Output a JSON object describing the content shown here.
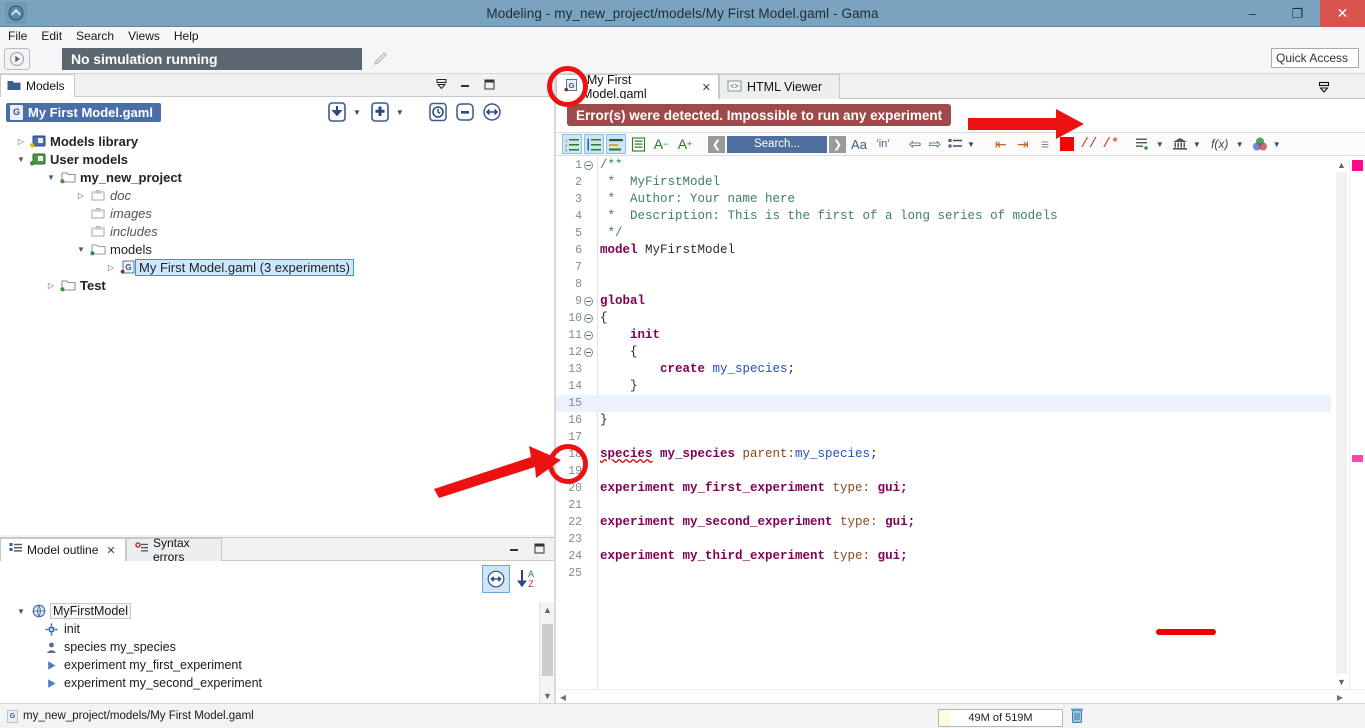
{
  "window": {
    "title": "Modeling - my_new_project/models/My First Model.gaml - Gama",
    "app_icon": "gama-app-icon",
    "minimize": "–",
    "maximize": "❐",
    "close": "✕"
  },
  "menu": {
    "items": [
      {
        "label": "File",
        "accel": "F"
      },
      {
        "label": "Edit",
        "accel": "E"
      },
      {
        "label": "Search",
        "accel": "a"
      },
      {
        "label": "Views",
        "accel": "V"
      },
      {
        "label": "Help",
        "accel": "H"
      }
    ]
  },
  "toolbar": {
    "run_icon": "play-icon",
    "simulation_status": "No simulation running",
    "edit_icon": "pencil-icon",
    "quick_access": "Quick Access"
  },
  "left_panel": {
    "tab": {
      "label": "Models",
      "icon": "folder-icon"
    },
    "view_controls": [
      "minimize-view-icon",
      "minimize-icon",
      "maximize-icon"
    ],
    "header_chip": {
      "label": "My First Model.gaml",
      "icon": "gaml-file-icon"
    },
    "tools": [
      {
        "name": "import-model-icon",
        "has_dropdown": true
      },
      {
        "name": "new-model-icon",
        "has_dropdown": true
      },
      {
        "name": "history-icon",
        "has_dropdown": false
      },
      {
        "name": "collapse-all-icon",
        "has_dropdown": false
      },
      {
        "name": "link-editor-icon",
        "has_dropdown": false
      }
    ],
    "tree": [
      {
        "label": "Models library",
        "indent": 0,
        "twist": "collapsed",
        "icon": "library-icon",
        "style": "bold"
      },
      {
        "label": "User models",
        "indent": 0,
        "twist": "expanded",
        "icon": "user-models-icon",
        "style": "bold"
      },
      {
        "label": "my_new_project",
        "indent": 1,
        "twist": "expanded",
        "icon": "project-folder-icon",
        "style": "bold"
      },
      {
        "label": "doc",
        "indent": 2,
        "twist": "collapsed",
        "icon": "folder-closed-icon",
        "style": "italic"
      },
      {
        "label": "images",
        "indent": 2,
        "twist": "none",
        "icon": "folder-closed-icon",
        "style": "italic"
      },
      {
        "label": "includes",
        "indent": 2,
        "twist": "none",
        "icon": "folder-closed-icon",
        "style": "italic"
      },
      {
        "label": "models",
        "indent": 2,
        "twist": "expanded",
        "icon": "folder-open-icon",
        "style": "plain"
      },
      {
        "label": "My First Model.gaml (3 experiments)",
        "indent": 3,
        "twist": "collapsed",
        "icon": "gaml-file-icon",
        "style": "selected"
      },
      {
        "label": "Test",
        "indent": 1,
        "twist": "collapsed",
        "icon": "project-folder-icon",
        "style": "bold"
      }
    ]
  },
  "outline_panel": {
    "tabs": [
      {
        "label": "Model outline",
        "icon": "outline-icon",
        "active": true,
        "closeable": true
      },
      {
        "label": "Syntax errors",
        "icon": "error-outline-icon",
        "active": false,
        "closeable": false
      }
    ],
    "view_controls": [
      "minimize-icon",
      "maximize-icon"
    ],
    "tools": [
      {
        "name": "link-with-editor-icon",
        "active": true
      },
      {
        "name": "sort-az-icon",
        "active": false
      }
    ],
    "items": [
      {
        "label": "MyFirstModel",
        "indent": 0,
        "twist": "expanded",
        "icon": "globe-icon",
        "selected": true
      },
      {
        "label": "init",
        "indent": 1,
        "twist": "none",
        "icon": "gear-icon",
        "selected": false
      },
      {
        "label": "species my_species",
        "indent": 1,
        "twist": "none",
        "icon": "person-icon",
        "selected": false
      },
      {
        "label": "experiment my_first_experiment",
        "indent": 1,
        "twist": "none",
        "icon": "play-triangle-icon",
        "selected": false
      },
      {
        "label": "experiment my_second_experiment",
        "indent": 1,
        "twist": "none",
        "icon": "play-triangle-icon",
        "selected": false
      }
    ]
  },
  "editor": {
    "tabs": [
      {
        "label": "*My First Model.gaml",
        "icon": "gaml-file-icon",
        "active": true,
        "closeable": true
      },
      {
        "label": "HTML Viewer",
        "icon": "html-viewer-icon",
        "active": false,
        "closeable": false
      }
    ],
    "restore_icon": "restore-view-icon",
    "error_banner": "Error(s) were detected. Impossible to run any experiment",
    "toolbar": [
      {
        "name": "outline-numbered-icon",
        "glyph": "≡",
        "active": true
      },
      {
        "name": "outline-tree-icon",
        "glyph": "≡",
        "active": true
      },
      {
        "name": "outline-mixed-icon",
        "glyph": "≡",
        "active": true
      },
      {
        "name": "word-wrap-icon",
        "glyph": "▤",
        "active": false
      },
      {
        "name": "decrease-font-icon",
        "glyph": "A⁻",
        "active": false
      },
      {
        "name": "increase-font-icon",
        "glyph": "A⁺",
        "active": false
      },
      {
        "name": "search-prev-icon",
        "glyph": "❮",
        "active": false
      },
      {
        "name": "search-input",
        "glyph": "Search...",
        "active": false
      },
      {
        "name": "search-next-icon",
        "glyph": "❯",
        "active": false
      },
      {
        "name": "case-sensitive-icon",
        "glyph": "Aa",
        "active": false
      },
      {
        "name": "whole-word-icon",
        "glyph": "'in'",
        "active": false
      },
      {
        "name": "navigate-back-icon",
        "glyph": "⇦",
        "active": false
      },
      {
        "name": "navigate-forward-icon",
        "glyph": "⇨",
        "active": false
      },
      {
        "name": "markers-list-icon",
        "glyph": "≔",
        "active": false,
        "has_dropdown": true
      },
      {
        "name": "unindent-icon",
        "glyph": "⇤",
        "active": false
      },
      {
        "name": "indent-icon",
        "glyph": "⇥",
        "active": false
      },
      {
        "name": "format-icon",
        "glyph": "≡",
        "active": false
      },
      {
        "name": "color-picker-icon",
        "glyph": "■",
        "active": false
      },
      {
        "name": "line-comment-icon",
        "glyph": "//",
        "active": false
      },
      {
        "name": "block-comment-icon",
        "glyph": "/*",
        "active": false
      },
      {
        "name": "insert-template-icon",
        "glyph": "≡+",
        "active": false,
        "has_dropdown": true
      },
      {
        "name": "built-in-icon",
        "glyph": "ἽB",
        "active": false,
        "has_dropdown": true
      },
      {
        "name": "function-icon",
        "glyph": "f(x)",
        "active": false,
        "has_dropdown": true
      },
      {
        "name": "palette-icon",
        "glyph": "●",
        "active": false,
        "has_dropdown": true
      }
    ],
    "search_placeholder": "Search...",
    "code_lines": [
      {
        "n": 1,
        "fold": true,
        "tokens": [
          {
            "t": "/**",
            "c": "cm"
          }
        ]
      },
      {
        "n": 2,
        "fold": false,
        "tokens": [
          {
            "t": " *  MyFirstModel",
            "c": "cm"
          }
        ]
      },
      {
        "n": 3,
        "fold": false,
        "tokens": [
          {
            "t": " *  Author: Your name here",
            "c": "cm"
          }
        ]
      },
      {
        "n": 4,
        "fold": false,
        "tokens": [
          {
            "t": " *  Description: This is the first of a long series of models",
            "c": "cm"
          }
        ]
      },
      {
        "n": 5,
        "fold": false,
        "tokens": [
          {
            "t": " */",
            "c": "cm"
          }
        ]
      },
      {
        "n": 6,
        "fold": false,
        "tokens": [
          {
            "t": "model",
            "c": "k"
          },
          {
            "t": " MyFirstModel",
            "c": "id"
          }
        ]
      },
      {
        "n": 7,
        "fold": false,
        "tokens": []
      },
      {
        "n": 8,
        "fold": false,
        "tokens": []
      },
      {
        "n": 9,
        "fold": true,
        "tokens": [
          {
            "t": "global",
            "c": "k"
          }
        ]
      },
      {
        "n": 10,
        "fold": true,
        "tokens": [
          {
            "t": "{",
            "c": "id"
          }
        ]
      },
      {
        "n": 11,
        "fold": true,
        "tokens": [
          {
            "t": "    init",
            "c": "k"
          }
        ]
      },
      {
        "n": 12,
        "fold": true,
        "tokens": [
          {
            "t": "    {",
            "c": "id"
          }
        ]
      },
      {
        "n": 13,
        "fold": false,
        "tokens": [
          {
            "t": "        create ",
            "c": "k"
          },
          {
            "t": "my_species",
            "c": "ty"
          },
          {
            "t": ";",
            "c": "id"
          }
        ]
      },
      {
        "n": 14,
        "fold": false,
        "tokens": [
          {
            "t": "    }",
            "c": "id"
          }
        ]
      },
      {
        "n": 15,
        "fold": false,
        "tokens": [],
        "highlight": true
      },
      {
        "n": 16,
        "fold": false,
        "tokens": [
          {
            "t": "}",
            "c": "id"
          }
        ]
      },
      {
        "n": 17,
        "fold": false,
        "tokens": []
      },
      {
        "n": 18,
        "fold": false,
        "tokens": [
          {
            "t": "species",
            "c": "err"
          },
          {
            "t": " my_species ",
            "c": "k"
          },
          {
            "t": "parent:",
            "c": "at"
          },
          {
            "t": "my_species",
            "c": "ty"
          },
          {
            "t": ";",
            "c": "id"
          }
        ],
        "has_error": true
      },
      {
        "n": 19,
        "fold": false,
        "tokens": []
      },
      {
        "n": 20,
        "fold": false,
        "tokens": [
          {
            "t": "experiment my_first_experiment ",
            "c": "k"
          },
          {
            "t": "type:",
            "c": "at"
          },
          {
            "t": " gui;",
            "c": "k"
          }
        ]
      },
      {
        "n": 21,
        "fold": false,
        "tokens": []
      },
      {
        "n": 22,
        "fold": false,
        "tokens": [
          {
            "t": "experiment my_second_experiment ",
            "c": "k"
          },
          {
            "t": "type:",
            "c": "at"
          },
          {
            "t": " gui;",
            "c": "k"
          }
        ]
      },
      {
        "n": 23,
        "fold": false,
        "tokens": []
      },
      {
        "n": 24,
        "fold": false,
        "tokens": [
          {
            "t": "experiment my_third_experiment ",
            "c": "k"
          },
          {
            "t": "type:",
            "c": "at"
          },
          {
            "t": " gui;",
            "c": "k"
          }
        ]
      },
      {
        "n": 25,
        "fold": false,
        "tokens": []
      }
    ]
  },
  "statusbar": {
    "path": "my_new_project/models/My First Model.gaml",
    "path_icon": "gaml-file-icon",
    "heap": "49M of 519M",
    "trash_icon": "trash-icon"
  },
  "annotations": {
    "circle_tab": "highlight-editor-tab",
    "circle_error_marker": "highlight-error-marker",
    "arrow_banner": "arrow-to-error-banner",
    "arrow_marker": "arrow-to-error-marker"
  },
  "colors": {
    "titlebar": "#7aa3c0",
    "error_banner": "#9e4a4a",
    "accent_blue": "#4a6ea9",
    "status_gray": "#5c6670",
    "annotation_red": "#ee1111",
    "marker_pink": "#ff0a8c"
  }
}
